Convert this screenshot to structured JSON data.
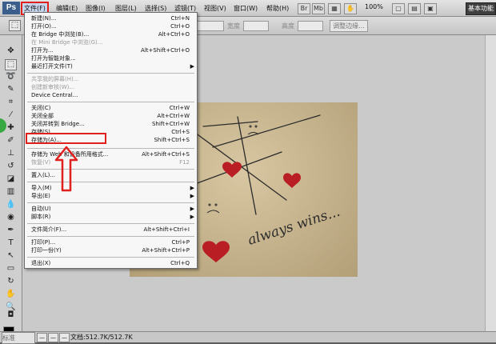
{
  "app": {
    "logo": "Ps",
    "workspace_button": "基本功能"
  },
  "menubar": {
    "items": [
      "文件(F)",
      "编辑(E)",
      "图像(I)",
      "图层(L)",
      "选择(S)",
      "滤镜(T)",
      "视图(V)",
      "窗口(W)",
      "帮助(H)"
    ],
    "zoom": "100%"
  },
  "options": {
    "width_label": "宽度",
    "height_label": "高度",
    "refine_button": "调整边缘..."
  },
  "file_menu": {
    "rows": [
      {
        "label": "新建(N)...",
        "shortcut": "Ctrl+N"
      },
      {
        "label": "打开(O)...",
        "shortcut": "Ctrl+O"
      },
      {
        "label": "在 Bridge 中浏览(B)...",
        "shortcut": "Alt+Ctrl+O"
      },
      {
        "label": "在 Mini Bridge 中浏览(G)...",
        "shortcut": "",
        "disabled": true
      },
      {
        "label": "打开为...",
        "shortcut": "Alt+Shift+Ctrl+O"
      },
      {
        "label": "打开为智能对象...",
        "shortcut": ""
      },
      {
        "label": "最近打开文件(T)",
        "shortcut": "",
        "arrow": "▶"
      },
      {
        "label": "共享我的屏幕(H)...",
        "shortcut": "",
        "disabled": true
      },
      {
        "label": "创建新审核(W)...",
        "shortcut": "",
        "disabled": true
      },
      {
        "label": "Device Central...",
        "shortcut": ""
      },
      {
        "label": "关闭(C)",
        "shortcut": "Ctrl+W"
      },
      {
        "label": "关闭全部",
        "shortcut": "Alt+Ctrl+W"
      },
      {
        "label": "关闭并转到 Bridge...",
        "shortcut": "Shift+Ctrl+W"
      },
      {
        "label": "存储(S)",
        "shortcut": "Ctrl+S"
      },
      {
        "label": "存储为(A)...",
        "shortcut": "Shift+Ctrl+S"
      },
      {
        "label": "存储为 Web 和设备所用格式...",
        "shortcut": "Alt+Shift+Ctrl+S"
      },
      {
        "label": "恢复(V)",
        "shortcut": "F12",
        "disabled": true
      },
      {
        "label": "置入(L)...",
        "shortcut": ""
      },
      {
        "label": "导入(M)",
        "shortcut": "",
        "arrow": "▶"
      },
      {
        "label": "导出(E)",
        "shortcut": "",
        "arrow": "▶"
      },
      {
        "label": "自动(U)",
        "shortcut": "",
        "arrow": "▶"
      },
      {
        "label": "脚本(R)",
        "shortcut": "",
        "arrow": "▶"
      },
      {
        "label": "文件简介(F)...",
        "shortcut": "Alt+Shift+Ctrl+I"
      },
      {
        "label": "打印(P)...",
        "shortcut": "Ctrl+P"
      },
      {
        "label": "打印一份(Y)",
        "shortcut": "Alt+Shift+Ctrl+P"
      },
      {
        "label": "退出(X)",
        "shortcut": "Ctrl+Q"
      }
    ]
  },
  "photo": {
    "text": "always wins..."
  },
  "status": {
    "zoom": "标准",
    "doc": "文档:512.7K/512.7K"
  },
  "colors": {
    "highlight": "#e0201c",
    "menu_bg": "#f7f7f7"
  }
}
